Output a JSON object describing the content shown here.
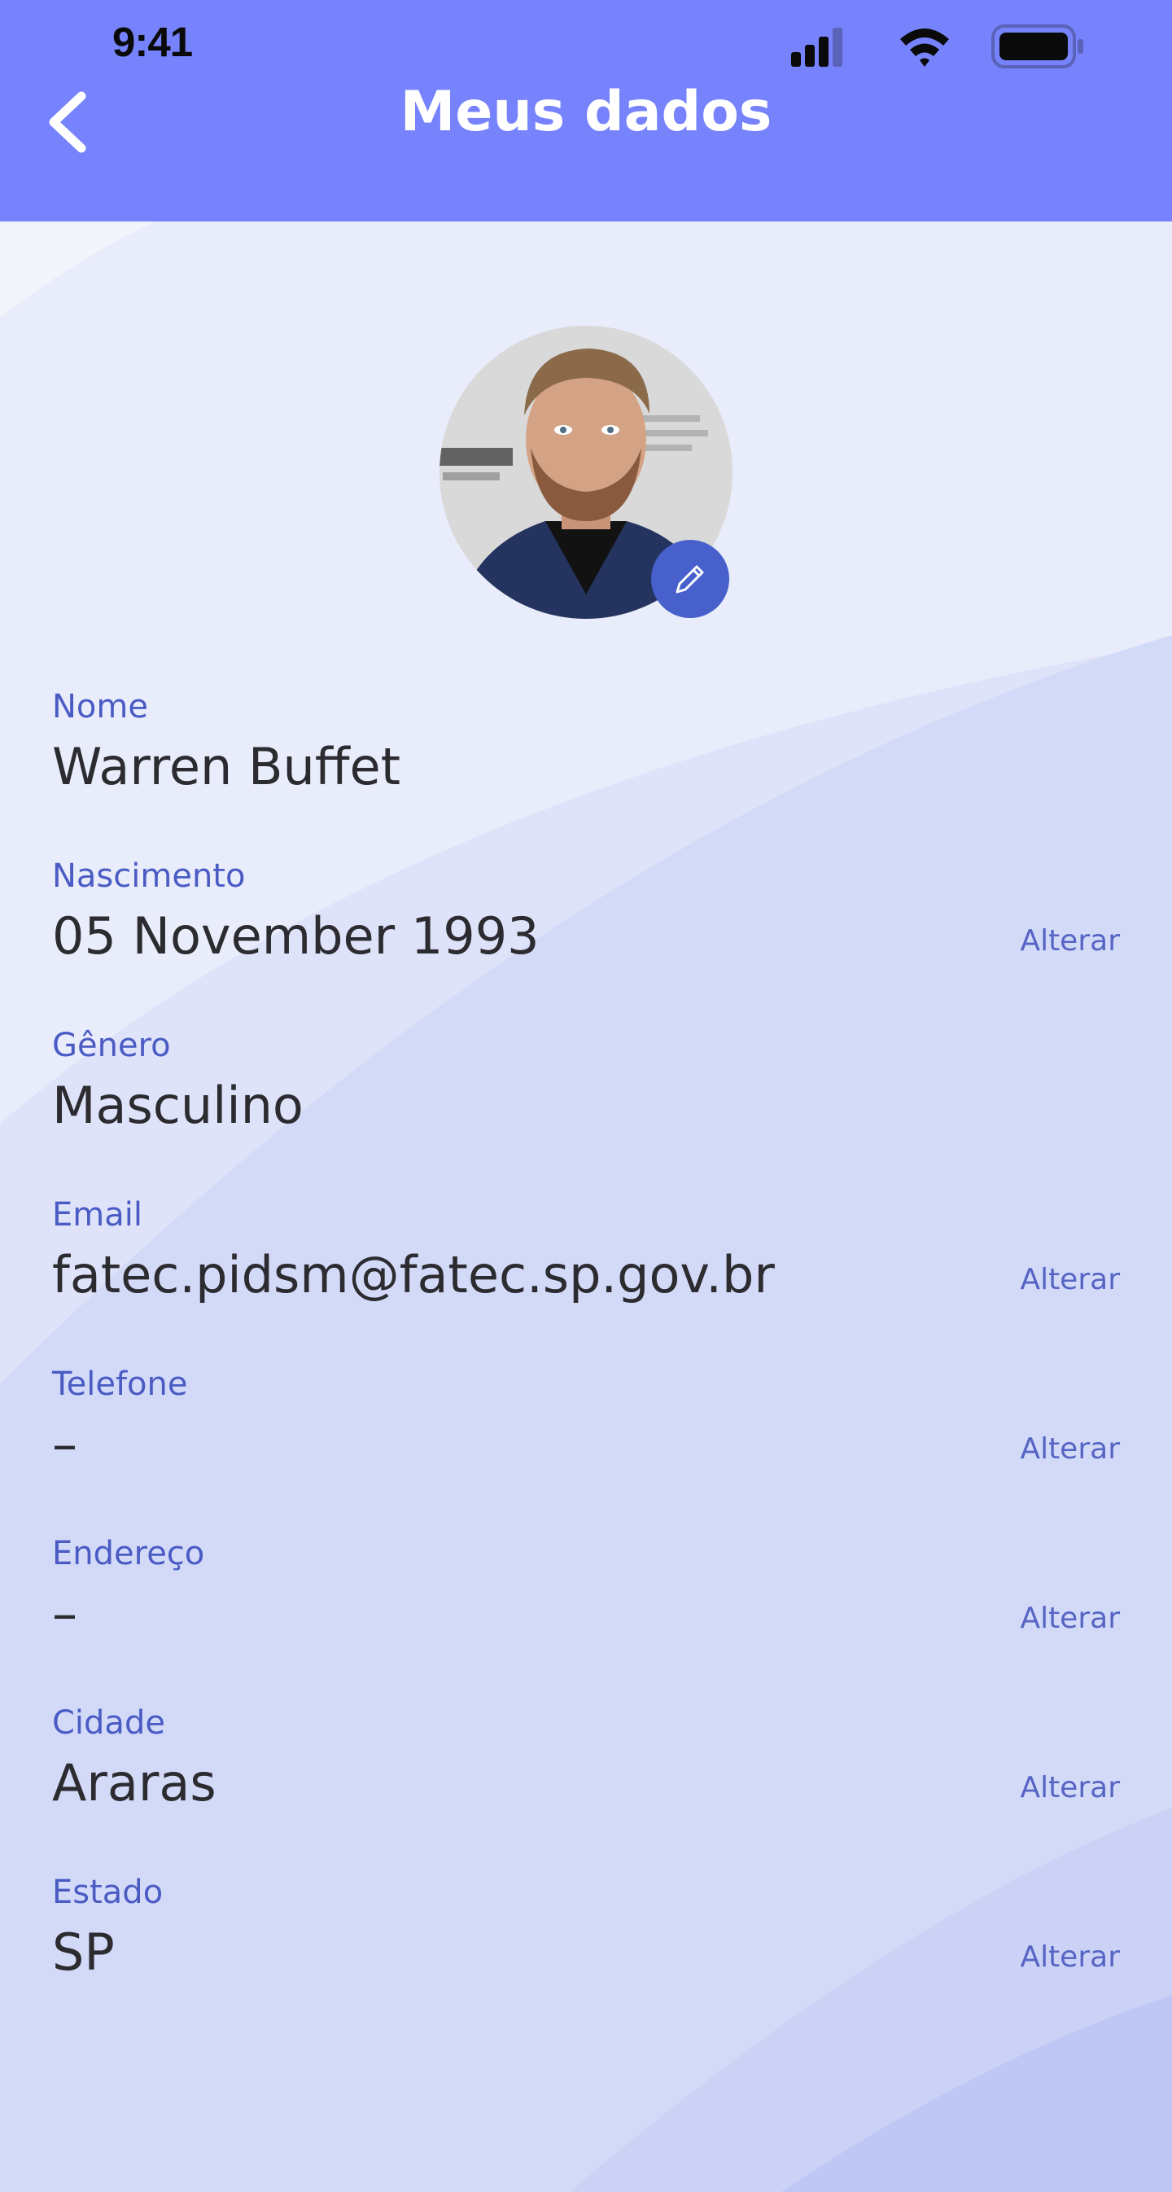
{
  "status_bar": {
    "time": "9:41",
    "icons": [
      "signal-icon",
      "wifi-icon",
      "battery-icon"
    ]
  },
  "header": {
    "title": "Meus dados",
    "back_icon": "chevron-left-icon"
  },
  "profile": {
    "avatar": "profile-photo",
    "edit_icon": "pencil-icon"
  },
  "fields": [
    {
      "label": "Nome",
      "value": "Warren Buffet",
      "action": ""
    },
    {
      "label": "Nascimento",
      "value": "05 November 1993",
      "action": "Alterar"
    },
    {
      "label": "Gênero",
      "value": "Masculino",
      "action": ""
    },
    {
      "label": "Email",
      "value": "fatec.pidsm@fatec.sp.gov.br",
      "action": "Alterar"
    },
    {
      "label": "Telefone",
      "value": "–",
      "action": "Alterar"
    },
    {
      "label": "Endereço",
      "value": "–",
      "action": "Alterar"
    },
    {
      "label": "Cidade",
      "value": "Araras",
      "action": "Alterar"
    },
    {
      "label": "Estado",
      "value": "SP",
      "action": "Alterar"
    }
  ],
  "colors": {
    "header": "#7683fc",
    "background": "#e9ecfb",
    "label": "#4a5bc4",
    "value": "#2b2b30",
    "action": "#5665c4",
    "edit_button": "#4760cb"
  }
}
